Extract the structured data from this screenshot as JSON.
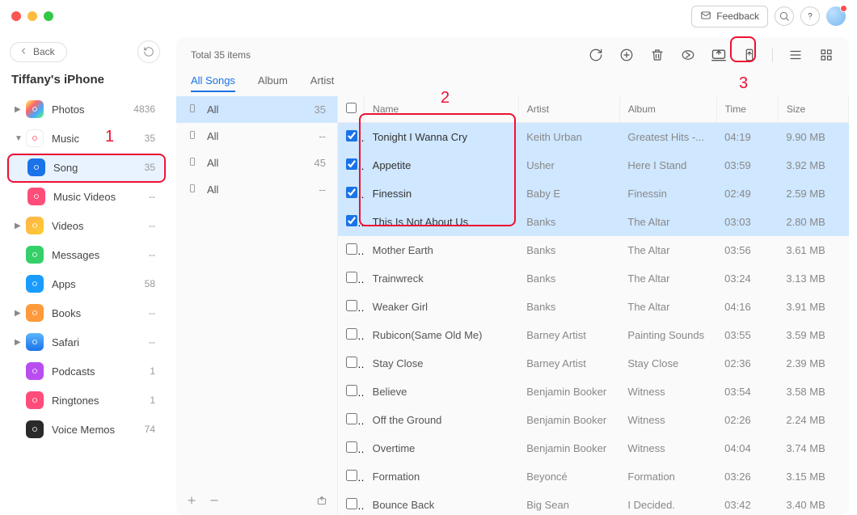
{
  "titlebar": {
    "feedback": "Feedback"
  },
  "sidebar": {
    "back": "Back",
    "device": "Tiffany's iPhone",
    "items": [
      {
        "label": "Photos",
        "count": "4836",
        "arrow": "right",
        "icon_bg": "linear-gradient(135deg,#ff6,#f66,#4af,#6f6)",
        "icon_fg": "#fff"
      },
      {
        "label": "Music",
        "count": "35",
        "arrow": "down",
        "icon_bg": "#fff",
        "icon_fg": "#ff4a6b",
        "border": "#eee"
      },
      {
        "label": "Song",
        "count": "35",
        "child": true,
        "icon_bg": "#1a73e8",
        "icon_fg": "#fff",
        "selected": true
      },
      {
        "label": "Music Videos",
        "count": "--",
        "child": true,
        "icon_bg": "#ff4d7a",
        "icon_fg": "#fff"
      },
      {
        "label": "Videos",
        "count": "--",
        "arrow": "right",
        "icon_bg": "linear-gradient(135deg,#ffb347,#ffcc33)",
        "icon_fg": "#fff"
      },
      {
        "label": "Messages",
        "count": "--",
        "icon_bg": "#35d06a",
        "icon_fg": "#fff"
      },
      {
        "label": "Apps",
        "count": "58",
        "icon_bg": "#1a9cff",
        "icon_fg": "#fff"
      },
      {
        "label": "Books",
        "count": "--",
        "arrow": "right",
        "icon_bg": "#ff9a3c",
        "icon_fg": "#fff"
      },
      {
        "label": "Safari",
        "count": "--",
        "arrow": "right",
        "icon_bg": "linear-gradient(180deg,#5bb6ff,#1a73e8)",
        "icon_fg": "#fff"
      },
      {
        "label": "Podcasts",
        "count": "1",
        "icon_bg": "#b84df0",
        "icon_fg": "#fff"
      },
      {
        "label": "Ringtones",
        "count": "1",
        "icon_bg": "#ff4d7a",
        "icon_fg": "#fff"
      },
      {
        "label": "Voice Memos",
        "count": "74",
        "icon_bg": "#2a2a2a",
        "icon_fg": "#fff"
      }
    ]
  },
  "toolbar": {
    "total": "Total 35 items"
  },
  "tabs": [
    {
      "label": "All Songs",
      "active": true
    },
    {
      "label": "Album"
    },
    {
      "label": "Artist"
    }
  ],
  "sub_list": [
    {
      "label": "All",
      "count": "35",
      "selected": true
    },
    {
      "label": "All",
      "count": "--"
    },
    {
      "label": "All",
      "count": "45"
    },
    {
      "label": "All",
      "count": "--"
    }
  ],
  "table": {
    "headers": {
      "name": "Name",
      "artist": "Artist",
      "album": "Album",
      "time": "Time",
      "size": "Size"
    },
    "rows": [
      {
        "sel": true,
        "name": "Tonight I Wanna Cry",
        "artist": "Keith Urban",
        "album": "Greatest Hits -...",
        "time": "04:19",
        "size": "9.90 MB"
      },
      {
        "sel": true,
        "name": "Appetite",
        "artist": "Usher",
        "album": "Here I Stand",
        "time": "03:59",
        "size": "3.92 MB"
      },
      {
        "sel": true,
        "name": "Finessin",
        "artist": "Baby E",
        "album": "Finessin",
        "time": "02:49",
        "size": "2.59 MB"
      },
      {
        "sel": true,
        "name": "This Is Not About Us",
        "artist": "Banks",
        "album": "The Altar",
        "time": "03:03",
        "size": "2.80 MB"
      },
      {
        "sel": false,
        "name": "Mother Earth",
        "artist": "Banks",
        "album": "The Altar",
        "time": "03:56",
        "size": "3.61 MB"
      },
      {
        "sel": false,
        "name": "Trainwreck",
        "artist": "Banks",
        "album": "The Altar",
        "time": "03:24",
        "size": "3.13 MB"
      },
      {
        "sel": false,
        "name": "Weaker Girl",
        "artist": "Banks",
        "album": "The Altar",
        "time": "04:16",
        "size": "3.91 MB"
      },
      {
        "sel": false,
        "name": "Rubicon(Same Old Me)",
        "artist": "Barney Artist",
        "album": "Painting Sounds",
        "time": "03:55",
        "size": "3.59 MB"
      },
      {
        "sel": false,
        "name": "Stay Close",
        "artist": "Barney Artist",
        "album": "Stay Close",
        "time": "02:36",
        "size": "2.39 MB"
      },
      {
        "sel": false,
        "name": "Believe",
        "artist": "Benjamin Booker",
        "album": "Witness",
        "time": "03:54",
        "size": "3.58 MB"
      },
      {
        "sel": false,
        "name": "Off the Ground",
        "artist": "Benjamin Booker",
        "album": "Witness",
        "time": "02:26",
        "size": "2.24 MB"
      },
      {
        "sel": false,
        "name": "Overtime",
        "artist": "Benjamin Booker",
        "album": "Witness",
        "time": "04:04",
        "size": "3.74 MB"
      },
      {
        "sel": false,
        "name": "Formation",
        "artist": "Beyoncé",
        "album": "Formation",
        "time": "03:26",
        "size": "3.15 MB"
      },
      {
        "sel": false,
        "name": "Bounce Back",
        "artist": "Big Sean",
        "album": "I Decided.",
        "time": "03:42",
        "size": "3.40 MB"
      }
    ]
  },
  "annotations": {
    "one": "1",
    "two": "2",
    "three": "3"
  }
}
